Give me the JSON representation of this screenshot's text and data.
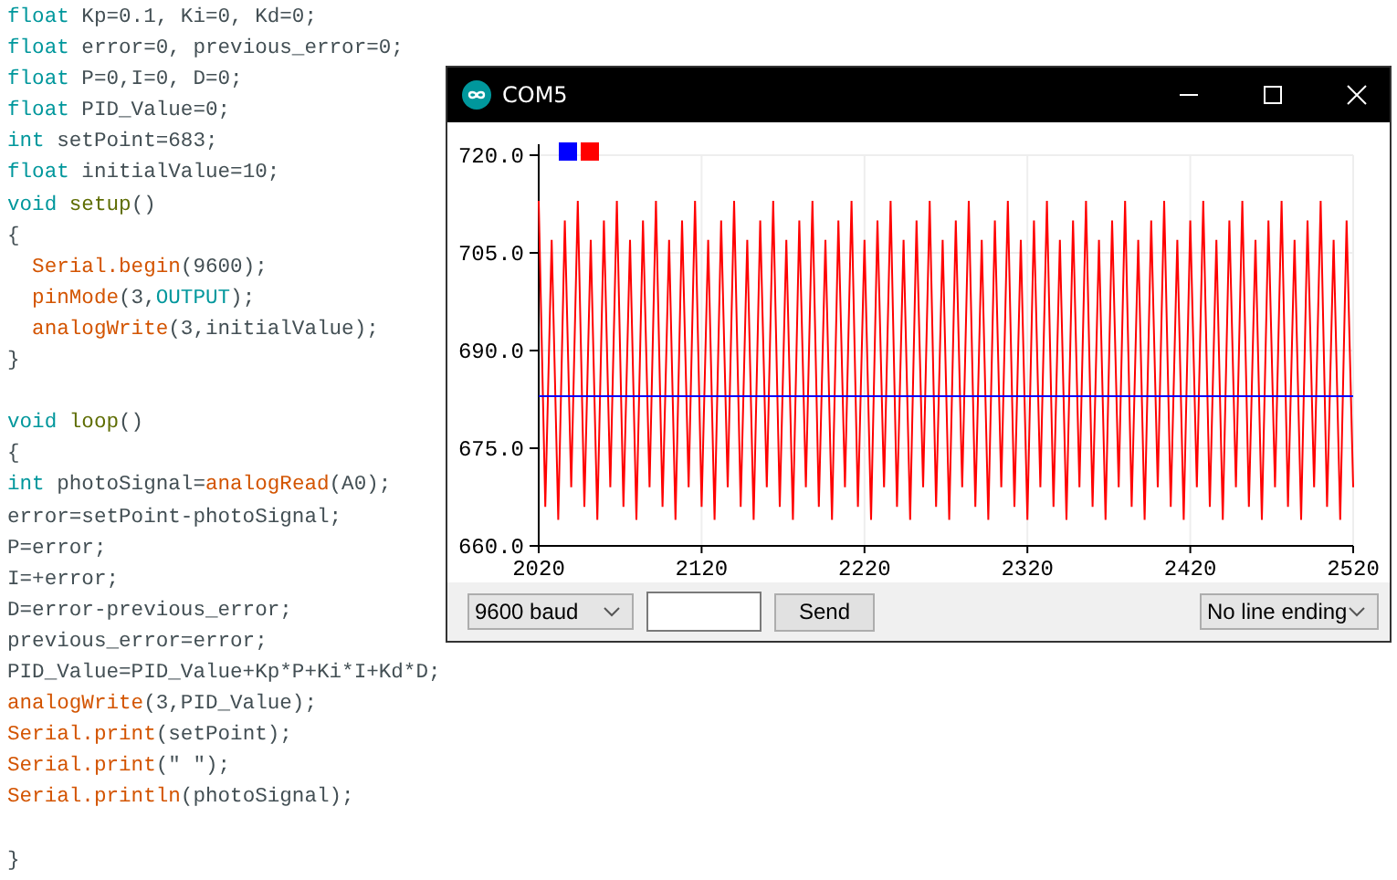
{
  "code_editor": {
    "blocks": [
      {
        "lines": [
          {
            "tokens": [
              {
                "kind": "keyword",
                "text": "float"
              },
              {
                "kind": "plain",
                "text": " Kp=0.1, Ki=0, Kd=0;"
              }
            ]
          },
          {
            "tokens": [
              {
                "kind": "keyword",
                "text": "float"
              },
              {
                "kind": "plain",
                "text": " error=0, previous_error=0;"
              }
            ]
          },
          {
            "tokens": [
              {
                "kind": "keyword",
                "text": "float"
              },
              {
                "kind": "plain",
                "text": " P=0,I=0, D=0;"
              }
            ]
          },
          {
            "tokens": [
              {
                "kind": "keyword",
                "text": "float"
              },
              {
                "kind": "plain",
                "text": " PID_Value=0;"
              }
            ]
          },
          {
            "tokens": [
              {
                "kind": "keyword",
                "text": "int"
              },
              {
                "kind": "plain",
                "text": " setPoint=683;"
              }
            ]
          },
          {
            "tokens": [
              {
                "kind": "keyword",
                "text": "float"
              },
              {
                "kind": "plain",
                "text": " initialValue=10;"
              }
            ]
          },
          {
            "tokens": [
              {
                "kind": "keyword",
                "text": "void "
              },
              {
                "kind": "structure",
                "text": "setup"
              },
              {
                "kind": "plain",
                "text": "()"
              }
            ]
          },
          {
            "tokens": [
              {
                "kind": "plain",
                "text": "{"
              }
            ]
          },
          {
            "tokens": [
              {
                "kind": "function",
                "text": "  Serial.begin"
              },
              {
                "kind": "plain",
                "text": "(9600);"
              }
            ]
          },
          {
            "tokens": [
              {
                "kind": "function",
                "text": "  pinMode"
              },
              {
                "kind": "plain",
                "text": "(3,"
              },
              {
                "kind": "keyword",
                "text": "OUTPUT"
              },
              {
                "kind": "plain",
                "text": ");"
              }
            ]
          },
          {
            "tokens": [
              {
                "kind": "function",
                "text": "  analogWrite"
              },
              {
                "kind": "plain",
                "text": "(3,initialValue);"
              }
            ]
          },
          {
            "tokens": [
              {
                "kind": "plain",
                "text": "}"
              }
            ]
          }
        ]
      },
      {
        "lines": [
          {
            "tokens": [
              {
                "kind": "keyword",
                "text": "void "
              },
              {
                "kind": "structure",
                "text": "loop"
              },
              {
                "kind": "plain",
                "text": "()"
              }
            ]
          },
          {
            "tokens": [
              {
                "kind": "plain",
                "text": "{"
              }
            ]
          },
          {
            "tokens": [
              {
                "kind": "keyword",
                "text": "int"
              },
              {
                "kind": "plain",
                "text": " photoSignal="
              },
              {
                "kind": "function",
                "text": "analogRead"
              },
              {
                "kind": "plain",
                "text": "(A0);"
              }
            ]
          },
          {
            "tokens": [
              {
                "kind": "plain",
                "text": "error=setPoint-photoSignal;"
              }
            ]
          },
          {
            "tokens": [
              {
                "kind": "plain",
                "text": "P=error;"
              }
            ]
          },
          {
            "tokens": [
              {
                "kind": "plain",
                "text": "I=+error;"
              }
            ]
          },
          {
            "tokens": [
              {
                "kind": "plain",
                "text": "D=error-previous_error;"
              }
            ]
          },
          {
            "tokens": [
              {
                "kind": "plain",
                "text": "previous_error=error;"
              }
            ]
          },
          {
            "tokens": [
              {
                "kind": "plain",
                "text": "PID_Value=PID_Value+Kp*P+Ki*I+Kd*D;"
              }
            ]
          },
          {
            "tokens": [
              {
                "kind": "function",
                "text": "analogWrite"
              },
              {
                "kind": "plain",
                "text": "(3,PID_Value);"
              }
            ]
          },
          {
            "tokens": [
              {
                "kind": "function",
                "text": "Serial.print"
              },
              {
                "kind": "plain",
                "text": "(setPoint);"
              }
            ]
          },
          {
            "tokens": [
              {
                "kind": "function",
                "text": "Serial.print"
              },
              {
                "kind": "plain",
                "text": "(\" \");"
              }
            ]
          },
          {
            "tokens": [
              {
                "kind": "function",
                "text": "Serial.println"
              },
              {
                "kind": "plain",
                "text": "(photoSignal);"
              }
            ]
          }
        ]
      },
      {
        "lines": [
          {
            "tokens": [
              {
                "kind": "plain",
                "text": "}"
              }
            ]
          }
        ]
      }
    ]
  },
  "plotter_window": {
    "title": "COM5",
    "chart_data": {
      "type": "line",
      "grid": true,
      "xlim": [
        2020,
        2520
      ],
      "ylim": [
        660,
        720
      ],
      "xticks": [
        2020,
        2120,
        2220,
        2320,
        2420,
        2520
      ],
      "yticks": [
        {
          "value": 660,
          "label": "660.0"
        },
        {
          "value": 675,
          "label": "675.0"
        },
        {
          "value": 690,
          "label": "690.0"
        },
        {
          "value": 705,
          "label": "705.0"
        },
        {
          "value": 720,
          "label": "720.0"
        }
      ],
      "x": [
        2020,
        2024,
        2028,
        2032,
        2036,
        2040,
        2044,
        2048,
        2052,
        2056,
        2060,
        2064,
        2068,
        2072,
        2076,
        2080,
        2084,
        2088,
        2092,
        2096,
        2100,
        2104,
        2108,
        2112,
        2116,
        2120,
        2124,
        2128,
        2132,
        2136,
        2140,
        2144,
        2148,
        2152,
        2156,
        2160,
        2164,
        2168,
        2172,
        2176,
        2180,
        2184,
        2188,
        2192,
        2196,
        2200,
        2204,
        2208,
        2212,
        2216,
        2220,
        2224,
        2228,
        2232,
        2236,
        2240,
        2244,
        2248,
        2252,
        2256,
        2260,
        2264,
        2268,
        2272,
        2276,
        2280,
        2284,
        2288,
        2292,
        2296,
        2300,
        2304,
        2308,
        2312,
        2316,
        2320,
        2324,
        2328,
        2332,
        2336,
        2340,
        2344,
        2348,
        2352,
        2356,
        2360,
        2364,
        2368,
        2372,
        2376,
        2380,
        2384,
        2388,
        2392,
        2396,
        2400,
        2404,
        2408,
        2412,
        2416,
        2420,
        2424,
        2428,
        2432,
        2436,
        2440,
        2444,
        2448,
        2452,
        2456,
        2460,
        2464,
        2468,
        2472,
        2476,
        2480,
        2484,
        2488,
        2492,
        2496,
        2500,
        2504,
        2508,
        2512,
        2516,
        2520
      ],
      "series": [
        {
          "color": "#ff0000",
          "values": [
            713,
            666,
            707,
            664,
            710,
            669,
            713,
            666,
            707,
            664,
            710,
            669,
            713,
            666,
            707,
            664,
            710,
            669,
            713,
            666,
            707,
            664,
            710,
            669,
            713,
            666,
            707,
            664,
            710,
            669,
            713,
            666,
            707,
            664,
            710,
            669,
            713,
            666,
            707,
            664,
            710,
            669,
            713,
            666,
            707,
            664,
            710,
            669,
            713,
            666,
            707,
            664,
            710,
            669,
            713,
            666,
            707,
            664,
            710,
            669,
            713,
            666,
            707,
            664,
            710,
            669,
            713,
            666,
            707,
            664,
            710,
            669,
            713,
            666,
            707,
            664,
            710,
            669,
            713,
            666,
            707,
            664,
            710,
            669,
            713,
            666,
            707,
            664,
            710,
            669,
            713,
            666,
            707,
            664,
            710,
            669,
            713,
            666,
            707,
            664,
            710,
            669,
            713,
            666,
            707,
            664,
            710,
            669,
            713,
            666,
            707,
            664,
            710,
            669,
            713,
            666,
            707,
            664,
            710,
            669,
            713,
            666,
            707,
            664,
            710,
            669
          ]
        },
        {
          "color": "#0000ff",
          "values": [
            683,
            683,
            683,
            683,
            683,
            683,
            683,
            683,
            683,
            683,
            683,
            683,
            683,
            683,
            683,
            683,
            683,
            683,
            683,
            683,
            683,
            683,
            683,
            683,
            683,
            683,
            683,
            683,
            683,
            683,
            683,
            683,
            683,
            683,
            683,
            683,
            683,
            683,
            683,
            683,
            683,
            683,
            683,
            683,
            683,
            683,
            683,
            683,
            683,
            683,
            683,
            683,
            683,
            683,
            683,
            683,
            683,
            683,
            683,
            683,
            683,
            683,
            683,
            683,
            683,
            683,
            683,
            683,
            683,
            683,
            683,
            683,
            683,
            683,
            683,
            683,
            683,
            683,
            683,
            683,
            683,
            683,
            683,
            683,
            683,
            683,
            683,
            683,
            683,
            683,
            683,
            683,
            683,
            683,
            683,
            683,
            683,
            683,
            683,
            683,
            683,
            683,
            683,
            683,
            683,
            683,
            683,
            683,
            683,
            683,
            683,
            683,
            683,
            683,
            683,
            683,
            683,
            683,
            683,
            683,
            683,
            683,
            683,
            683,
            683,
            683
          ]
        }
      ]
    },
    "baud_rate": "9600 baud",
    "send_button": "Send",
    "line_ending": "No line ending"
  }
}
